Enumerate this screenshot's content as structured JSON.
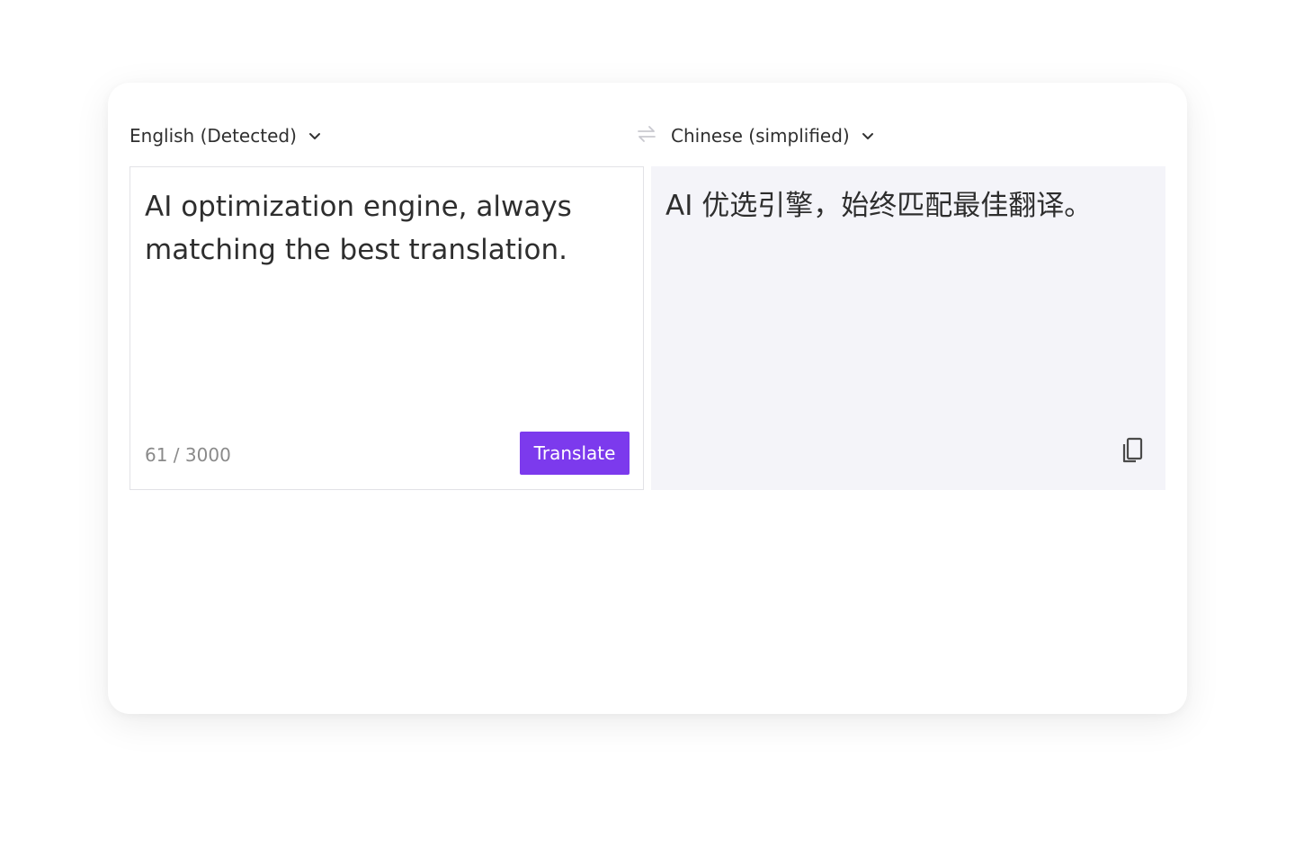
{
  "source_language": {
    "label": "English (Detected)",
    "icon": "chevron-down-icon"
  },
  "swap": {
    "icon": "swap-arrows-icon"
  },
  "target_language": {
    "label": "Chinese (simplified)",
    "icon": "chevron-down-icon"
  },
  "source_panel": {
    "text": "AI optimization engine, always matching the best translation.",
    "char_count": "61 / 3000",
    "translate_label": "Translate"
  },
  "target_panel": {
    "text": "AI 优选引擎，始终匹配最佳翻译。",
    "copy_icon": "copy-icon"
  },
  "colors": {
    "accent": "#7c3aed",
    "target_background": "#f4f4f9",
    "muted_text": "#8a8a8a"
  }
}
